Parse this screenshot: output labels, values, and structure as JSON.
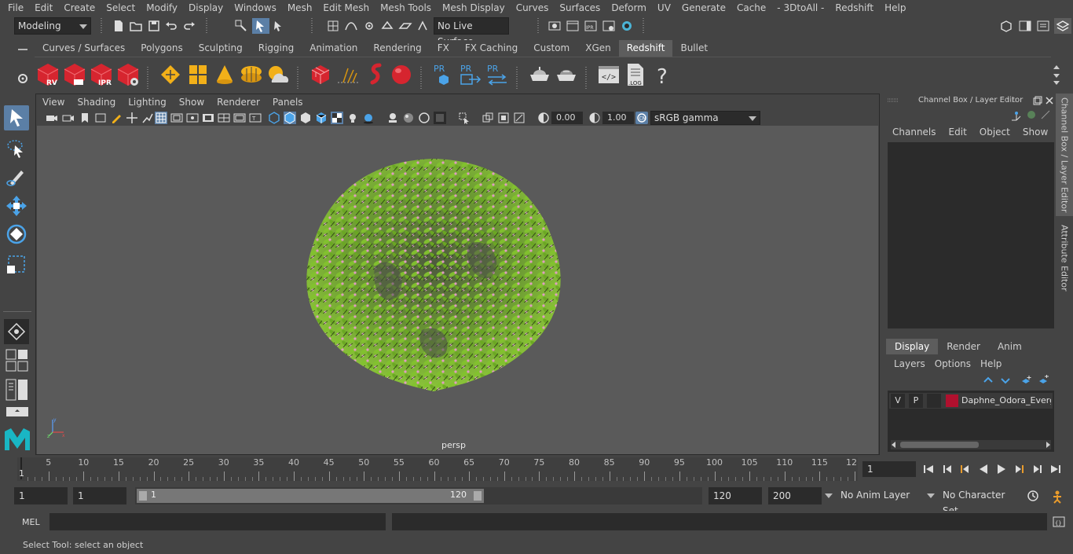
{
  "menubar": [
    "File",
    "Edit",
    "Create",
    "Select",
    "Modify",
    "Display",
    "Windows",
    "Mesh",
    "Edit Mesh",
    "Mesh Tools",
    "Mesh Display",
    "Curves",
    "Surfaces",
    "Deform",
    "UV",
    "Generate",
    "Cache",
    "- 3DtoAll -",
    "Redshift",
    "Help"
  ],
  "status": {
    "mode": "Modeling",
    "live_surface": "No Live Surface"
  },
  "shelf_tabs": [
    {
      "label": "Curves / Surfaces"
    },
    {
      "label": "Polygons"
    },
    {
      "label": "Sculpting"
    },
    {
      "label": "Rigging"
    },
    {
      "label": "Animation"
    },
    {
      "label": "Rendering"
    },
    {
      "label": "FX"
    },
    {
      "label": "FX Caching"
    },
    {
      "label": "Custom"
    },
    {
      "label": "XGen"
    },
    {
      "label": "Redshift",
      "active": true
    },
    {
      "label": "Bullet"
    }
  ],
  "shelf_labels": {
    "rv": "RV",
    "ipr": "IPR",
    "pr1": "PR",
    "pr2": "PR",
    "pr3": "PR",
    "log": ".LOG",
    "help": "?"
  },
  "viewport": {
    "menu": [
      "View",
      "Shading",
      "Lighting",
      "Show",
      "Renderer",
      "Panels"
    ],
    "exposure": "0.00",
    "gamma": "1.00",
    "color_space": "sRGB gamma",
    "camera_label": "persp"
  },
  "channelbox": {
    "title": "Channel Box / Layer Editor",
    "menu": [
      "Channels",
      "Edit",
      "Object",
      "Show"
    ]
  },
  "layer_editor": {
    "tabs": [
      "Display",
      "Render",
      "Anim"
    ],
    "menu": [
      "Layers",
      "Options",
      "Help"
    ],
    "layer": {
      "v": "V",
      "p": "P",
      "name": "Daphne_Odora_Evergreen",
      "color": "#b0102e"
    }
  },
  "side_tabs": [
    "Channel Box / Layer Editor",
    "Attribute Editor"
  ],
  "timeline": {
    "ticks": [
      "5",
      "10",
      "15",
      "20",
      "25",
      "30",
      "35",
      "40",
      "45",
      "50",
      "55",
      "60",
      "65",
      "70",
      "75",
      "80",
      "85",
      "90",
      "95",
      "100",
      "105",
      "110",
      "115",
      "12"
    ],
    "start_label": "1",
    "current_frame": "1"
  },
  "range": {
    "start": "1",
    "anim_start": "1",
    "slider_start": "1",
    "slider_end": "120",
    "end": "120",
    "anim_end": "200",
    "anim_layer": "No Anim Layer",
    "character_set": "No Character Set"
  },
  "cmdline": {
    "lang": "MEL"
  },
  "helpline": "Select Tool: select an object",
  "colors": {
    "accent": "#5b7fa6",
    "redshift_red": "#d6252f",
    "foliage": "#7dc22a",
    "flower": "#e59ac8"
  }
}
